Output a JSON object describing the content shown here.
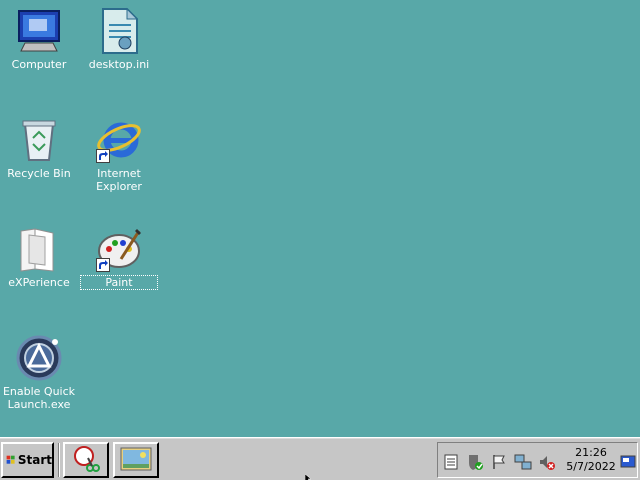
{
  "desktop": {
    "background_color": "#58a8a8",
    "icons": [
      {
        "label": "Computer",
        "icon": "computer-icon",
        "shortcut": false,
        "selected": false
      },
      {
        "label": "desktop.ini",
        "icon": "settings-file-icon",
        "shortcut": false,
        "selected": false
      },
      {
        "label": "Recycle Bin",
        "icon": "recycle-bin-icon",
        "shortcut": false,
        "selected": false
      },
      {
        "label": "Internet Explorer",
        "icon": "internet-explorer-icon",
        "shortcut": true,
        "selected": false
      },
      {
        "label": "eXPerience",
        "icon": "folder-icon",
        "shortcut": false,
        "selected": false
      },
      {
        "label": "Paint",
        "icon": "paint-icon",
        "shortcut": true,
        "selected": true
      },
      {
        "label": "Enable Quick Launch.exe",
        "icon": "app-exe-icon",
        "shortcut": false,
        "selected": false
      }
    ]
  },
  "taskbar": {
    "start_label": "Start",
    "quick_launch": [
      {
        "icon": "snipping-tool-icon"
      },
      {
        "icon": "show-desktop-icon"
      }
    ],
    "tray": {
      "icons": [
        "notepad-tray-icon",
        "security-shield-icon",
        "action-center-flag-icon",
        "network-icon",
        "volume-muted-icon"
      ],
      "time": "21:26",
      "date": "5/7/2022",
      "show_desktop_icon": "show-desktop-corner-icon"
    }
  }
}
